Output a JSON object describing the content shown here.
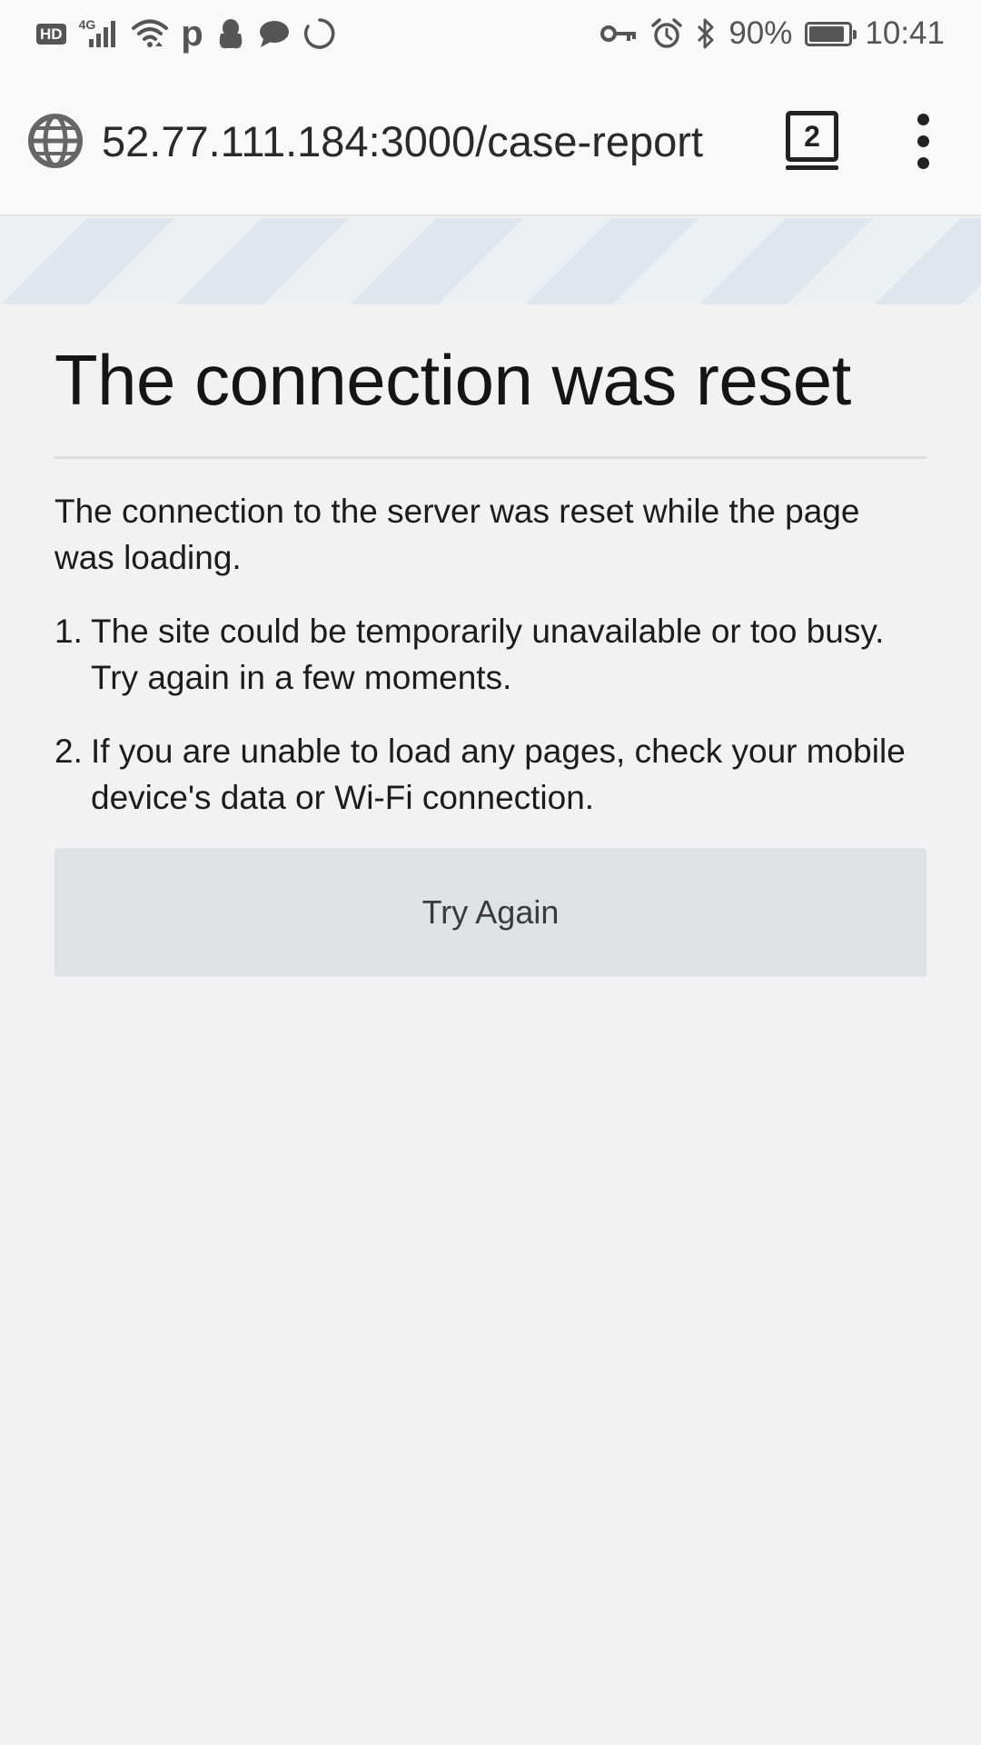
{
  "status_bar": {
    "hd": "HD",
    "network": "4G",
    "p_icon": "p",
    "battery_percent": "90%",
    "battery_level": 0.9,
    "time": "10:41",
    "icons_left": [
      "hd-icon",
      "signal-icon",
      "wifi-icon",
      "p-app-icon",
      "penguin-icon",
      "chat-bubble-icon",
      "loading-ring-icon"
    ],
    "icons_right": [
      "key-icon",
      "alarm-icon",
      "bluetooth-icon",
      "battery-icon"
    ]
  },
  "address_bar": {
    "url": "52.77.111.184:3000/case-report",
    "tab_count": "2",
    "icons": [
      "globe-icon",
      "tabs-icon",
      "overflow-menu-icon"
    ]
  },
  "error_page": {
    "title": "The connection was reset",
    "description": "The connection to the server was reset while the page was loading.",
    "reasons": [
      {
        "number": "1.",
        "text": "The site could be temporarily unavailable or too busy. Try again in a few moments."
      },
      {
        "number": "2.",
        "text": "If you are unable to load any pages, check your mobile device's data or Wi-Fi connection."
      }
    ],
    "try_again_label": "Try Again"
  },
  "colors": {
    "background": "#f2f2f2",
    "toolbar": "#f9f9f9",
    "button": "#e0e1e5",
    "stripe_light": "#edf0f3",
    "stripe_dark": "#dfe6ee"
  }
}
